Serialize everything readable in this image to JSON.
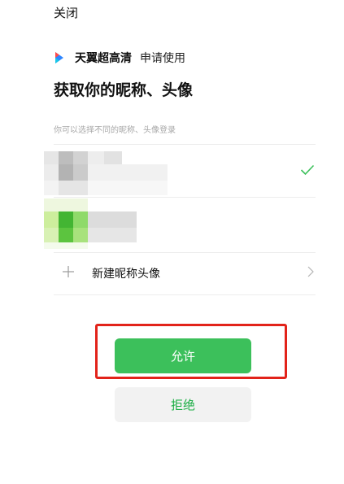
{
  "header": {
    "close_label": "关闭"
  },
  "app": {
    "name": "天翼超高清",
    "request_label": "申请使用",
    "logo_icon": "app-logo-icon"
  },
  "title": "获取你的昵称、头像",
  "hint": "你可以选择不同的昵称、头像登录",
  "profiles": [
    {
      "selected": true,
      "avatar": "blurred",
      "check_icon": "checkmark-icon"
    },
    {
      "selected": false,
      "avatar": "blurred"
    }
  ],
  "new_profile": {
    "label": "新建昵称头像",
    "plus_icon": "plus-icon",
    "chevron_icon": "chevron-right-icon"
  },
  "buttons": {
    "allow_label": "允许",
    "reject_label": "拒绝"
  },
  "colors": {
    "accent": "#3cc05b",
    "reject_text": "#1aad44",
    "highlight": "#e2231a"
  }
}
